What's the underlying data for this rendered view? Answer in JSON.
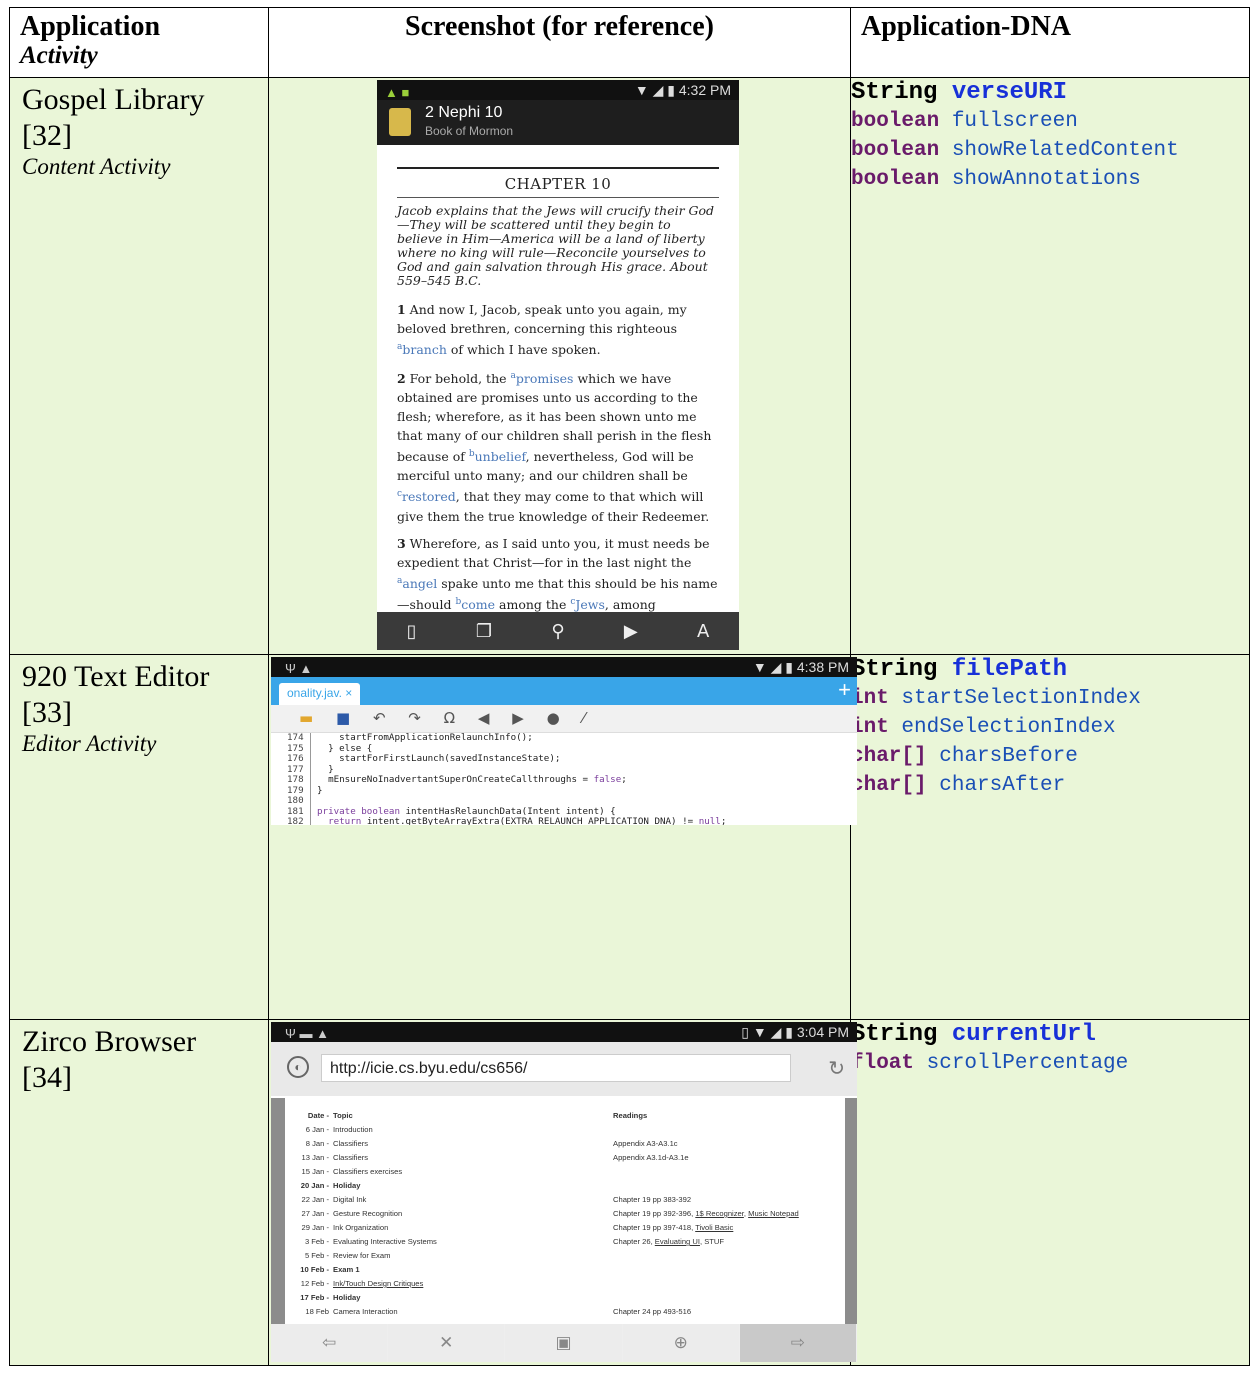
{
  "headers": {
    "col1_title": "Application",
    "col1_subtitle": "Activity",
    "col2_title": "Screenshot (for reference)",
    "col3_title": "Application-DNA"
  },
  "rows": [
    {
      "name": "Gospel Library",
      "ref": "[32]",
      "activity": "Content Activity",
      "dna": [
        {
          "type": "String",
          "var": "verseURI"
        },
        {
          "type": "boolean",
          "var": "fullscreen"
        },
        {
          "type": "boolean",
          "var": "showRelatedContent"
        },
        {
          "type": "boolean",
          "var": "showAnnotations"
        }
      ]
    },
    {
      "name": "920 Text Editor",
      "ref": "[33]",
      "activity": "Editor Activity",
      "dna": [
        {
          "type": "String",
          "var": "filePath"
        },
        {
          "type": "int",
          "var": "startSelectionIndex"
        },
        {
          "type": "int",
          "var": "endSelectionIndex"
        },
        {
          "type": "char[]",
          "var": "charsBefore"
        },
        {
          "type": "char[]",
          "var": "charsAfter"
        }
      ]
    },
    {
      "name": "Zirco Browser",
      "ref": "[34]",
      "activity": "",
      "dna": [
        {
          "type": "String",
          "var": "currentUrl"
        },
        {
          "type": "float",
          "var": "scrollPercentage"
        }
      ]
    }
  ],
  "gospel_shot": {
    "time": "4:32 PM",
    "title": "2 Nephi 10",
    "subtitle": "Book of Mormon",
    "chapter": "CHAPTER 10",
    "summary": "Jacob explains that the Jews will crucify their God —They will be scattered until they begin to believe in Him—America will be a land of liberty where no king will rule—Reconcile yourselves to God and gain salvation through His grace. About 559–545 B.C."
  },
  "editor_shot": {
    "time": "4:38 PM",
    "tab": "onality.jav. ×",
    "plus": "+"
  },
  "zirco_shot": {
    "time": "3:04 PM",
    "url": "http://icie.cs.byu.edu/cs656/",
    "col_date": "Date",
    "col_topic": "Topic",
    "col_readings": "Readings"
  }
}
